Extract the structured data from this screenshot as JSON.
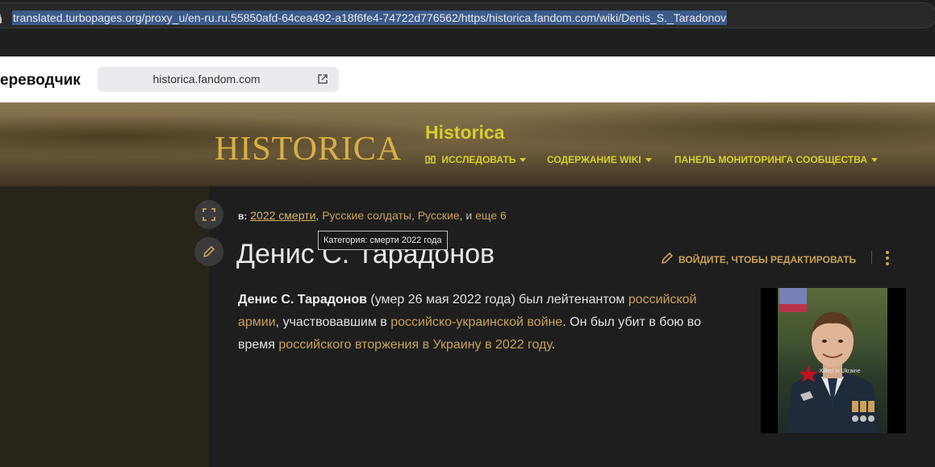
{
  "browser": {
    "url": "translated.turbopages.org/proxy_u/en-ru.ru.55850afd-64cea492-a18f6fe4-74722d776562/https/historica.fandom.com/wiki/Denis_S._Taradonov"
  },
  "translator": {
    "title": "ереводчик",
    "domain": "historica.fandom.com"
  },
  "site": {
    "logo_text": "HISTORICA",
    "name": "Historica",
    "nav": {
      "explore": "ИССЛЕДОВАТЬ",
      "wiki_content": "СОДЕРЖАНИЕ WIKI",
      "community_panel": "ПАНЕЛЬ МОНИТОРИНГА СООБЩЕСТВА"
    }
  },
  "article": {
    "categories_label": "в:",
    "categories": [
      "2022 смерти",
      "Русские солдаты",
      "Русские"
    ],
    "categories_and": ", и ",
    "categories_more": "еще 6",
    "tooltip": "Категория: смерти 2022 года",
    "title": "Денис С. Тарадонов",
    "edit_label": "ВОЙДИТЕ, ЧТОБЫ РЕДАКТИРОВАТЬ",
    "paragraph": {
      "bold_name": "Денис С. Тарадонов",
      "t1": " (умер 26 мая 2022 года) был лейтенантом ",
      "l1": "российской армии",
      "t2": ", участвовавшим в ",
      "l2": "российско-украинской войне",
      "t3": ". Он был убит в бою во время ",
      "l3": "российского вторжения в Украину в 2022 году",
      "t4": "."
    },
    "image_watermark": "Killed in Ukraine"
  },
  "colors": {
    "accent_gold": "#c9a25a",
    "nav_yellow": "#d6cf2e",
    "logo_gold": "#d8b046"
  }
}
